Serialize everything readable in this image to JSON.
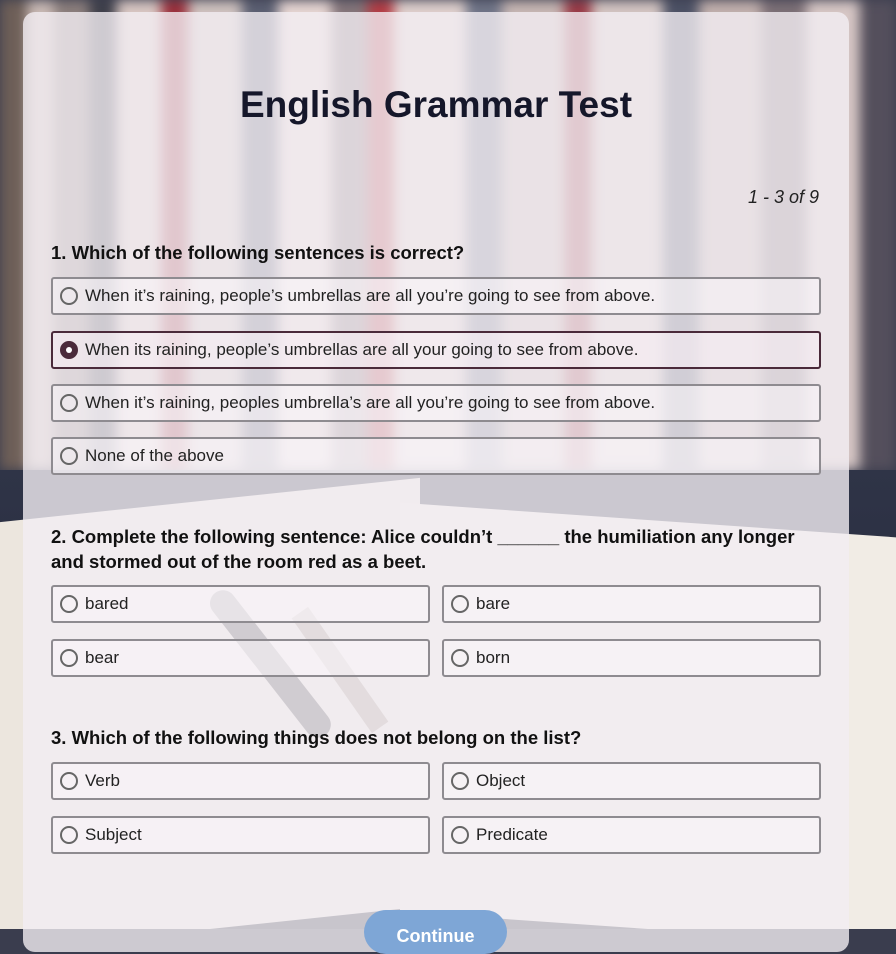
{
  "title": "English Grammar Test",
  "pager": "1 - 3 of 9",
  "questions": [
    {
      "text": "1.  Which of the following sentences is correct?",
      "options": [
        "When it’s raining, people’s umbrellas are all you’re going to see from above.",
        "When its raining, people’s umbrellas are all your going to see from above.",
        "When it’s raining, peoples umbrella’s are all you’re going to see from above.",
        "None of the above"
      ],
      "selected_index": 1
    },
    {
      "text": "2. Complete the following sentence: Alice couldn’t ______ the humiliation any longer and stormed out of the room red as a beet.",
      "options": [
        "bared",
        "bare",
        "bear",
        "born"
      ]
    },
    {
      "text": "3. Which of the following things does not belong on the list?",
      "options": [
        "Verb",
        "Object",
        "Subject",
        "Predicate"
      ]
    }
  ],
  "continue_label": "Continue",
  "colors": {
    "accent": "#7ea6d6",
    "selected": "#4a2a3a",
    "title": "#15172a"
  }
}
